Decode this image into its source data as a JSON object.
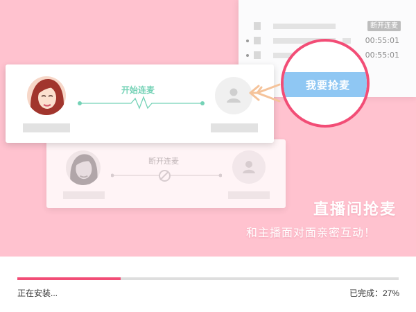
{
  "banner": {
    "background_color": "#ffc2cf",
    "slogan_main": "直播间抢麦",
    "slogan_sub": "和主播面对面亲密互动！"
  },
  "list_panel": {
    "rows": [
      {
        "tag": "断开连麦"
      },
      {
        "time": "00:55:01"
      },
      {
        "time": "00:55:01"
      }
    ]
  },
  "link_card": {
    "link_label": "开始连麦",
    "accent_color": "#74d2b6"
  },
  "faded_card": {
    "link_label": "断开连麦"
  },
  "magnifier": {
    "button_label": "我要抢麦",
    "ring_color": "#f24d76",
    "button_color": "#8fc7f3",
    "arrow_color": "#f5c39a"
  },
  "install": {
    "status": "正在安装...",
    "done_label": "已完成：27%",
    "progress": 0.27,
    "progress_color": "#f24d76"
  }
}
